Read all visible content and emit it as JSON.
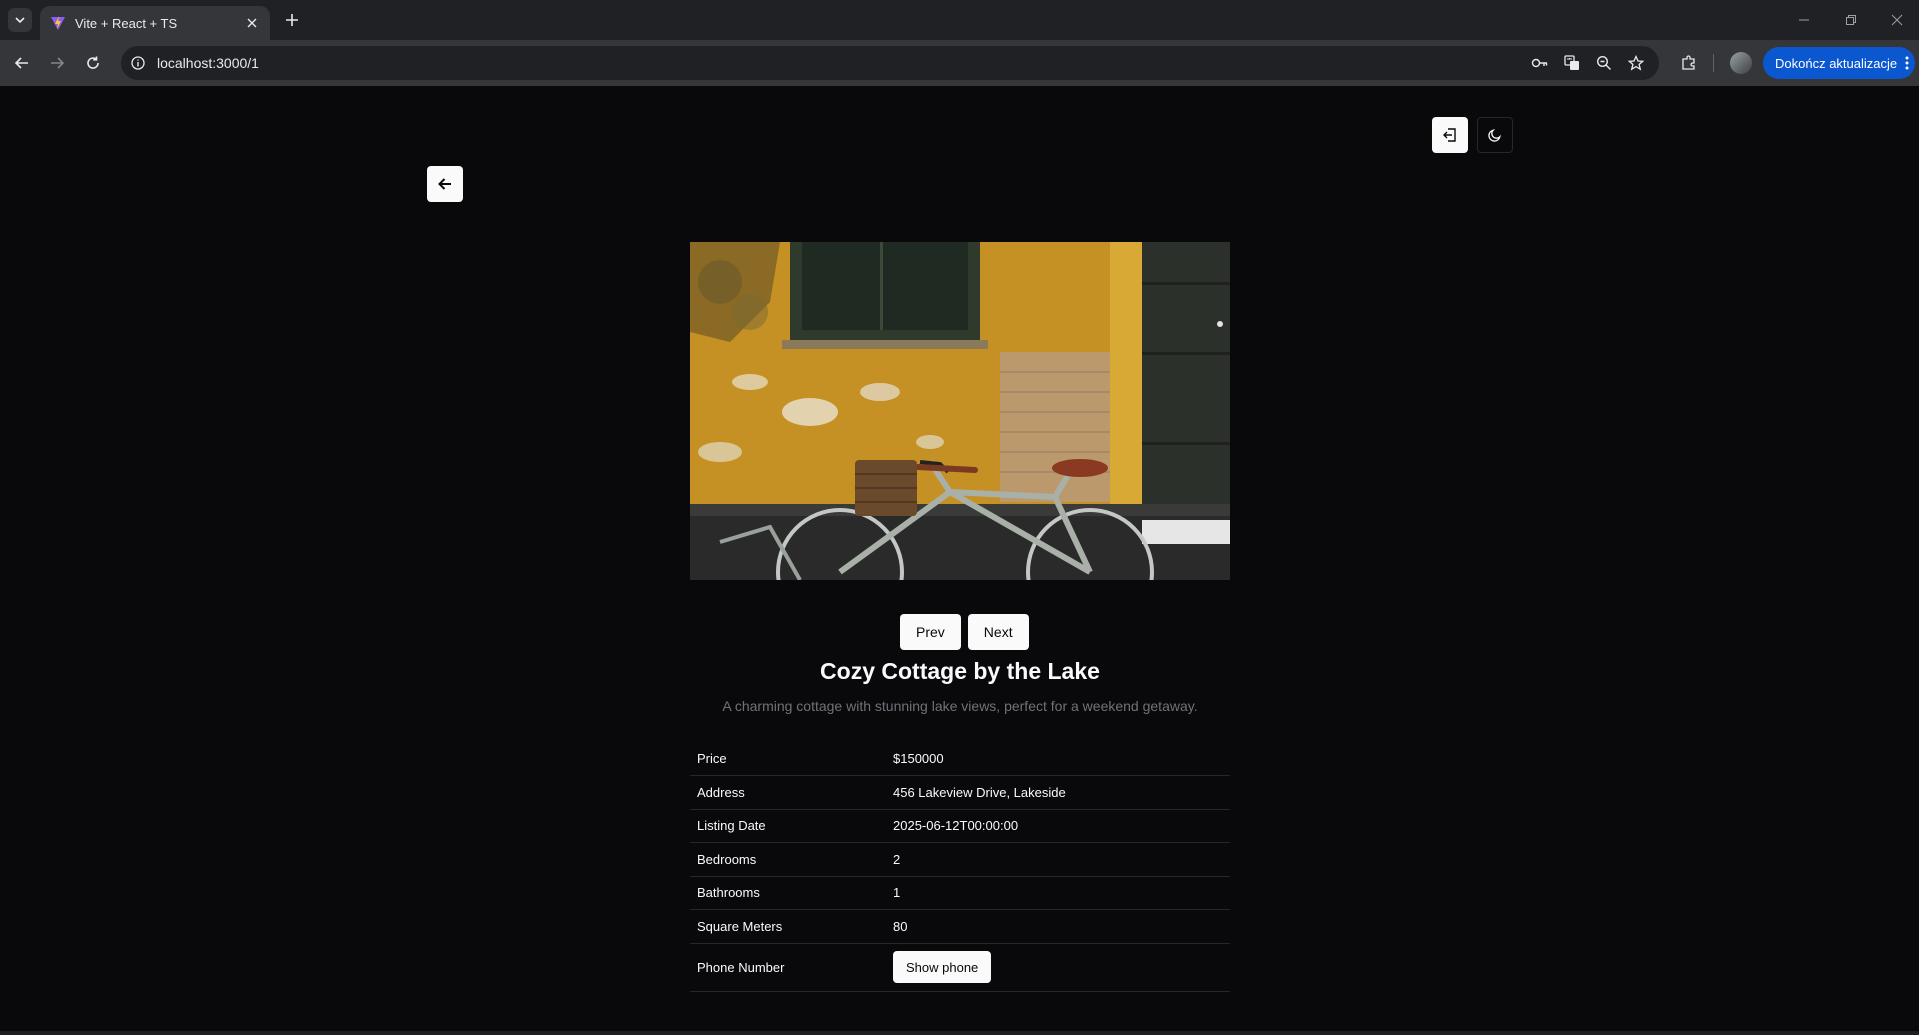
{
  "browser": {
    "tab_title": "Vite + React + TS",
    "url": "localhost:3000/1",
    "update_button_label": "Dokończ aktualizacje"
  },
  "page": {
    "title": "Cozy Cottage by the Lake",
    "description": "A charming cottage with stunning lake views, perfect for a weekend getaway.",
    "prev_label": "Prev",
    "next_label": "Next",
    "photo_alt": "Bicycle leaning against a yellow weathered wall",
    "details": [
      {
        "label": "Price",
        "value": "$150000"
      },
      {
        "label": "Address",
        "value": "456 Lakeview Drive, Lakeside"
      },
      {
        "label": "Listing Date",
        "value": "2025-06-12T00:00:00"
      },
      {
        "label": "Bedrooms",
        "value": "2"
      },
      {
        "label": "Bathrooms",
        "value": "1"
      },
      {
        "label": "Square Meters",
        "value": "80"
      }
    ],
    "phone_label": "Phone Number",
    "show_phone_label": "Show phone"
  },
  "colors": {
    "background": "#09090b",
    "foreground": "#fafafa",
    "muted": "#71717a",
    "border": "#27272a",
    "update_accent": "#0b57d0"
  }
}
